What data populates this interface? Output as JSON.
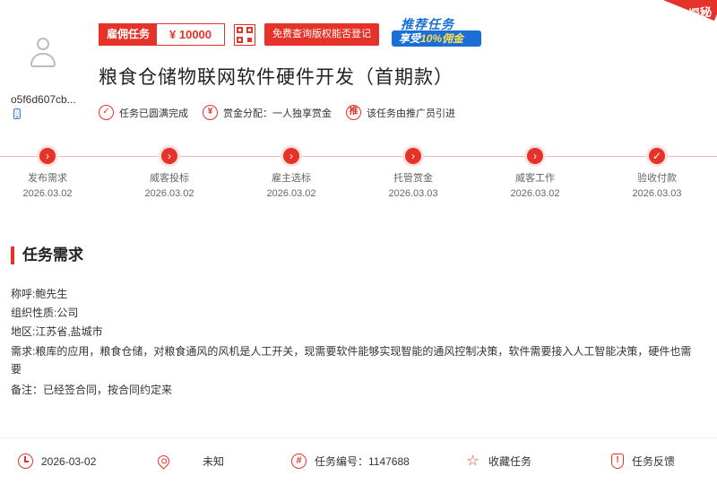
{
  "user": {
    "name": "o5f6d607cb..."
  },
  "badge": {
    "label": "雇佣任务",
    "amount": "¥ 10000"
  },
  "copyright_button": "免费查询版权能否登记",
  "promo": {
    "line1": "推荐任务",
    "line2_prefix": "享受",
    "line2_highlight": "10%佣金"
  },
  "corner": {
    "label": "探秘"
  },
  "task_title": "粮食仓储物联网软件硬件开发（首期款）",
  "meta": [
    {
      "icon": "check-circle-icon",
      "text": "任务已圆满完成"
    },
    {
      "icon": "yen-circle-icon",
      "text": "赏金分配：一人独享赏金"
    },
    {
      "icon": "promote-circle-icon",
      "glyph": "推",
      "text": "该任务由推广员引进"
    }
  ],
  "steps": [
    {
      "name": "发布需求",
      "date": "2026.03.02",
      "done": false
    },
    {
      "name": "威客投标",
      "date": "2026.03.02",
      "done": false
    },
    {
      "name": "雇主选标",
      "date": "2026.03.02",
      "done": false
    },
    {
      "name": "托管赏金",
      "date": "2026.03.03",
      "done": false
    },
    {
      "name": "威客工作",
      "date": "2026.03.02",
      "done": false
    },
    {
      "name": "验收付款",
      "date": "2026.03.03",
      "done": true
    }
  ],
  "section": {
    "title": "任务需求"
  },
  "requirement": {
    "contact": "称呼:鲍先生",
    "org": "组织性质:公司",
    "region": "地区:江苏省,盐城市",
    "need": "需求:粮库的应用，粮食仓储，对粮食通风的风机是人工开关，现需要软件能够实现智能的通风控制决策，软件需要接入人工智能决策，硬件也需要",
    "remark": "备注：已经签合同，按合同约定来"
  },
  "footer": {
    "date": "2026-03-02",
    "location": "未知",
    "task_no": "任务编号：1147688",
    "favorite": "收藏任务",
    "feedback": "任务反馈"
  },
  "colors": {
    "accent": "#e5332a",
    "promo_blue": "#1a6fd6"
  }
}
